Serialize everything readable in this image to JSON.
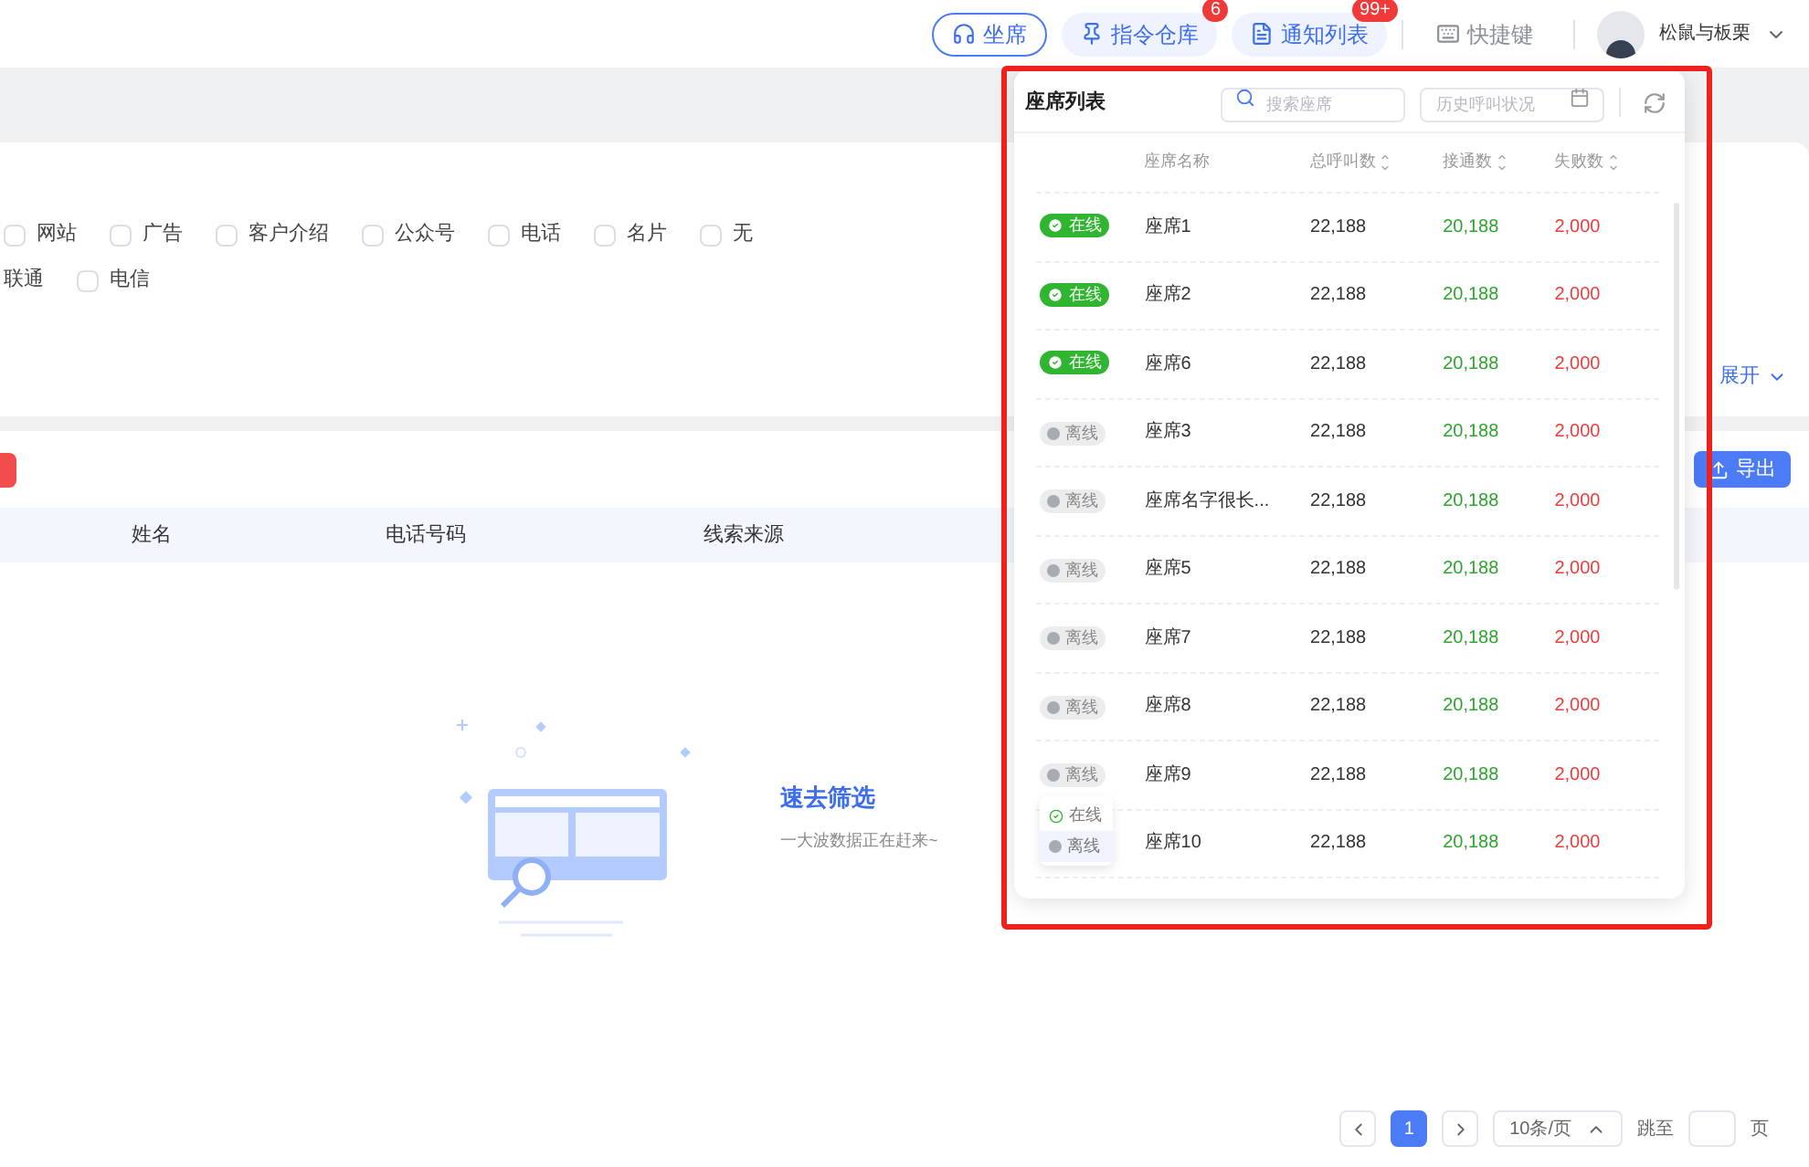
{
  "topbar": {
    "buttons": [
      {
        "kind": "outline",
        "label": "坐席"
      },
      {
        "kind": "pill",
        "label": "指令仓库",
        "badge": "6"
      },
      {
        "kind": "pill",
        "label": "通知列表",
        "badge": "99+"
      },
      {
        "kind": "plain",
        "label": "快捷键"
      }
    ],
    "user": {
      "name": "松鼠与板栗"
    }
  },
  "filters": {
    "rows": [
      [
        {
          "kind": "checkbox",
          "label": "网站",
          "checked": false
        },
        {
          "kind": "checkbox",
          "label": "广告",
          "checked": false
        },
        {
          "kind": "checkbox",
          "label": "客户介绍",
          "checked": false
        },
        {
          "kind": "checkbox",
          "label": "公众号",
          "checked": false
        },
        {
          "kind": "checkbox",
          "label": "电话",
          "checked": false
        },
        {
          "kind": "checkbox",
          "label": "名片",
          "checked": false
        },
        {
          "kind": "checkbox",
          "label": "无",
          "checked": false
        }
      ],
      [
        {
          "kind": "label",
          "label": "联通"
        },
        {
          "kind": "checkbox",
          "label": "电信",
          "checked": false
        }
      ]
    ],
    "expand": "展开"
  },
  "toolbar": {
    "export": "导出"
  },
  "table": {
    "columns": [
      "姓名",
      "电话号码",
      "线索来源"
    ]
  },
  "empty": {
    "title": "速去筛选",
    "subtitle": "一大波数据正在赶来~"
  },
  "pagination": {
    "pages": [
      {
        "label": "1",
        "selected": true
      }
    ],
    "page_size": "10条/页",
    "jump_label": "跳至",
    "page_unit": "页"
  },
  "seat_panel": {
    "title": "座席列表",
    "search": {
      "placeholder": "搜索座席"
    },
    "date": {
      "placeholder": "历史呼叫状况"
    },
    "columns": [
      {
        "label": "座席名称",
        "sortable": false
      },
      {
        "label": "总呼叫数",
        "sortable": true
      },
      {
        "label": "接通数",
        "sortable": true
      },
      {
        "label": "失败数",
        "sortable": true
      }
    ],
    "rows": [
      {
        "status": "在线",
        "online": true,
        "name": "座席1",
        "total": "22,188",
        "connected": "20,188",
        "failed": "2,000"
      },
      {
        "status": "在线",
        "online": true,
        "name": "座席2",
        "total": "22,188",
        "connected": "20,188",
        "failed": "2,000"
      },
      {
        "status": "在线",
        "online": true,
        "name": "座席6",
        "total": "22,188",
        "connected": "20,188",
        "failed": "2,000"
      },
      {
        "status": "离线",
        "online": false,
        "name": "座席3",
        "total": "22,188",
        "connected": "20,188",
        "failed": "2,000"
      },
      {
        "status": "离线",
        "online": false,
        "name": "座席名字很长...",
        "total": "22,188",
        "connected": "20,188",
        "failed": "2,000"
      },
      {
        "status": "离线",
        "online": false,
        "name": "座席5",
        "total": "22,188",
        "connected": "20,188",
        "failed": "2,000"
      },
      {
        "status": "离线",
        "online": false,
        "name": "座席7",
        "total": "22,188",
        "connected": "20,188",
        "failed": "2,000"
      },
      {
        "status": "离线",
        "online": false,
        "name": "座席8",
        "total": "22,188",
        "connected": "20,188",
        "failed": "2,000"
      },
      {
        "status": "离线",
        "online": false,
        "name": "座席9",
        "total": "22,188",
        "connected": "20,188",
        "failed": "2,000"
      },
      {
        "name": "座席10",
        "total": "22,188",
        "connected": "20,188",
        "failed": "2,000"
      }
    ],
    "status_menu": {
      "options": [
        {
          "label": "在线",
          "online": true,
          "selected": false
        },
        {
          "label": "离线",
          "online": false,
          "selected": true
        }
      ]
    }
  }
}
